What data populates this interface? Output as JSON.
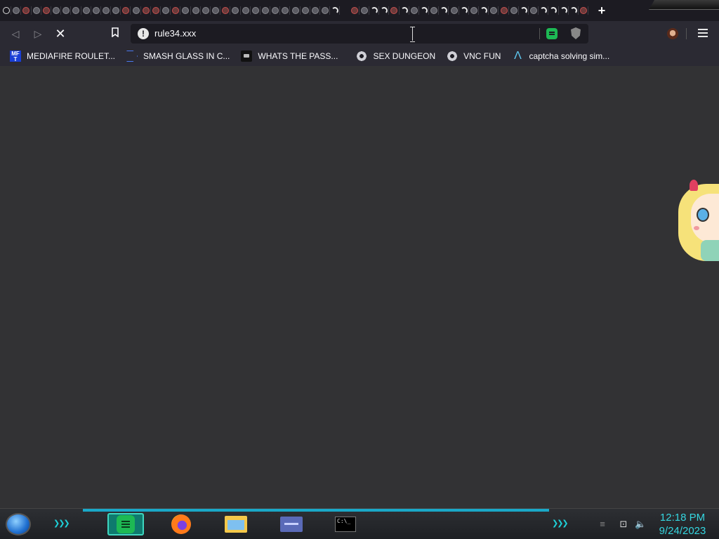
{
  "browser": {
    "tabs": [
      "history",
      "gray",
      "red",
      "gray",
      "red",
      "gray",
      "gray",
      "gray",
      "gray",
      "gray",
      "gray",
      "gray",
      "red",
      "gray",
      "red",
      "red",
      "gray",
      "red",
      "gray",
      "gray",
      "gray",
      "gray",
      "red",
      "gray",
      "gray",
      "gray",
      "gray",
      "gray",
      "gray",
      "gray",
      "gray",
      "gray",
      "gray",
      "spin",
      "gap",
      "red",
      "gray",
      "spin",
      "spin",
      "red",
      "spin",
      "gray",
      "spin",
      "gray",
      "spin",
      "gray",
      "spin",
      "gray",
      "spin",
      "gray",
      "red",
      "gray",
      "spin",
      "gray",
      "spin",
      "spin",
      "spin",
      "spin",
      "red"
    ],
    "new_tab_icon": "plus-icon",
    "url": "rule34.xxx",
    "site_info_icon": "info-icon",
    "bookmarks": [
      {
        "label": "MEDIAFIRE ROULET...",
        "icon": "mediafire-icon"
      },
      {
        "label": "SMASH GLASS IN C...",
        "icon": "chevron-icon"
      },
      {
        "label": "WHATS THE PASS...",
        "icon": "dark-box-icon"
      },
      {
        "label": "SEX DUNGEON",
        "icon": "gear-icon"
      },
      {
        "label": "VNC FUN",
        "icon": "gear-icon"
      },
      {
        "label": "captcha solving sim...",
        "icon": "lambda-icon"
      }
    ]
  },
  "taskbar": {
    "apps": [
      "spotify",
      "firefox",
      "file-explorer",
      "control-panel",
      "command-prompt"
    ],
    "active_app": "spotify",
    "cmd_icon_text": "C:\\_",
    "clock": {
      "time": "12:18 PM",
      "date": "9/24/2023"
    },
    "accent_color": "#35d6e0"
  }
}
